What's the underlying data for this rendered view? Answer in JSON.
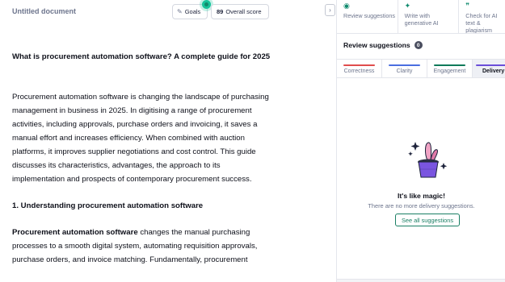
{
  "document": {
    "title": "Untitled document",
    "heading": "What is procurement automation software? A complete guide for 2025",
    "intro": "Procurement automation software is changing the landscape of purchasing management in business in 2025. In digitising a range of procurement activities, including approvals, purchase orders and invoicing, it saves a manual effort and increases efficiency. When combined with auction platforms, it improves supplier negotiations and cost control. This guide discusses its characteristics, advantages, the approach to its implementation and prospects of contemporary procurement success.",
    "section_heading": "1. Understanding procurement automation software",
    "section_bold": "Procurement automation software",
    "section_text": " changes the manual purchasing processes to a smooth digital system, automating requisition approvals, purchase orders, and invoice matching. Fundamentally, procurement"
  },
  "toolbar": {
    "goals_label": "Goals",
    "score_value": "89",
    "score_label": "Overall score",
    "collapse_icon": "chevron-right-icon"
  },
  "panel": {
    "tools": [
      {
        "icon": "grammarly-icon",
        "label": "Review suggestions"
      },
      {
        "icon": "sparkle-icon",
        "label": "Write with generative AI"
      },
      {
        "icon": "quote-icon",
        "label": "Check for AI text & plagiarism"
      }
    ],
    "review_title": "Review suggestions",
    "review_count": "0",
    "categories": [
      {
        "label": "Correctness",
        "color": "#e04c4c"
      },
      {
        "label": "Clarity",
        "color": "#4a6ee0"
      },
      {
        "label": "Engagement",
        "color": "#0f7a5a"
      },
      {
        "label": "Delivery",
        "color": "#6b4ed9"
      }
    ],
    "empty_title": "It's like magic!",
    "empty_subtitle": "There are no more delivery suggestions.",
    "see_all": "See all suggestions"
  }
}
